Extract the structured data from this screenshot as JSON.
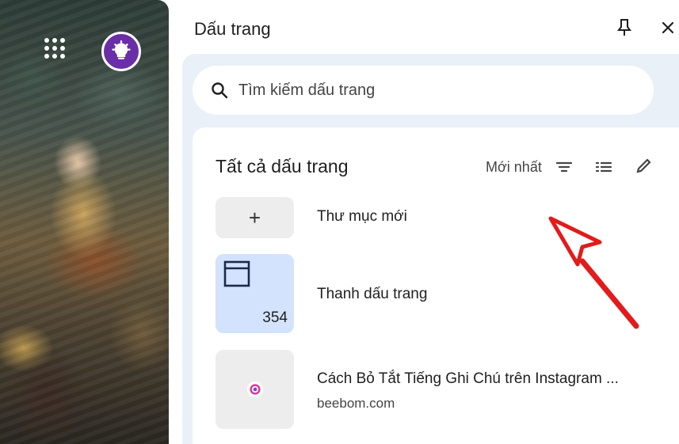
{
  "panel": {
    "title": "Dấu trang"
  },
  "search": {
    "placeholder": "Tìm kiếm dấu trang"
  },
  "list": {
    "heading": "Tất cả dấu trang",
    "sort_label": "Mới nhất",
    "items": [
      {
        "name": "Thư mục mới",
        "icon": "plus-icon"
      },
      {
        "name": "Thanh dấu trang",
        "icon": "folder-window-icon",
        "count": "354"
      },
      {
        "name": "Cách Bỏ Tắt Tiếng Ghi Chú trên Instagram ...",
        "domain": "beebom.com",
        "icon": "beebom-favicon"
      }
    ]
  },
  "colors": {
    "card_bg": "#eaf0f8",
    "folder_tile": "#d3e3fd",
    "annotation_arrow": "#e21b1b",
    "launcher_button": "#6a2fa8"
  }
}
